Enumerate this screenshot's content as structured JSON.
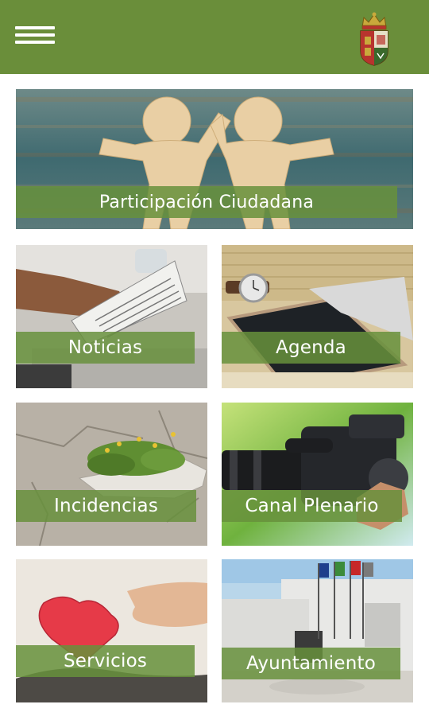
{
  "header": {
    "menu_icon": "hamburger-menu-icon",
    "crest_icon": "coat-of-arms-icon",
    "bar_color": "#6a8e3a"
  },
  "tiles": [
    {
      "id": "participacion",
      "label": "Participación Ciudadana",
      "image": "paper-figures-high-five"
    },
    {
      "id": "noticias",
      "label": "Noticias",
      "image": "hands-holding-newspaper"
    },
    {
      "id": "agenda",
      "label": "Agenda",
      "image": "tablet-and-wristwatch"
    },
    {
      "id": "incidencias",
      "label": "Incidencias",
      "image": "broken-pavement-with-plants"
    },
    {
      "id": "canal",
      "label": "Canal Plenario",
      "image": "video-camera"
    },
    {
      "id": "servicios",
      "label": "Servicios",
      "image": "hands-holding-heart"
    },
    {
      "id": "ayuntamiento",
      "label": "Ayuntamiento",
      "image": "town-hall-building-with-flags"
    }
  ],
  "label_bar_color": "#67913c"
}
